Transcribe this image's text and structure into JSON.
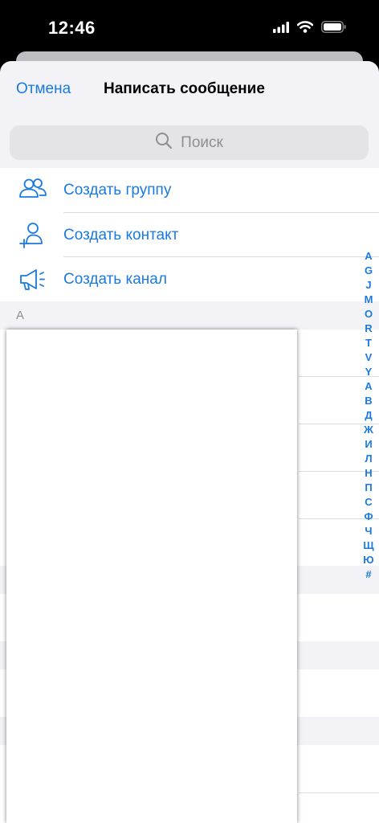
{
  "status_bar": {
    "time": "12:46",
    "icons": [
      "cellular-signal-icon",
      "wifi-icon",
      "battery-icon"
    ]
  },
  "nav": {
    "cancel_label": "Отмена",
    "title": "Написать сообщение"
  },
  "search": {
    "placeholder": "Поиск"
  },
  "actions": [
    {
      "label": "Создать группу",
      "icon": "group-icon"
    },
    {
      "label": "Создать контакт",
      "icon": "add-contact-icon"
    },
    {
      "label": "Создать канал",
      "icon": "megaphone-icon"
    }
  ],
  "contacts": {
    "section_letter": "A"
  },
  "index_letters": [
    "A",
    "G",
    "J",
    "M",
    "O",
    "R",
    "T",
    "V",
    "Y",
    "А",
    "В",
    "Д",
    "Ж",
    "И",
    "Л",
    "Н",
    "П",
    "С",
    "Ф",
    "Ч",
    "Щ",
    "Ю",
    "#"
  ],
  "colors": {
    "accent": "#1a7ae0",
    "background": "#f2f2f7",
    "separator": "#dcdce0",
    "secondary_text": "#8e8e93"
  }
}
